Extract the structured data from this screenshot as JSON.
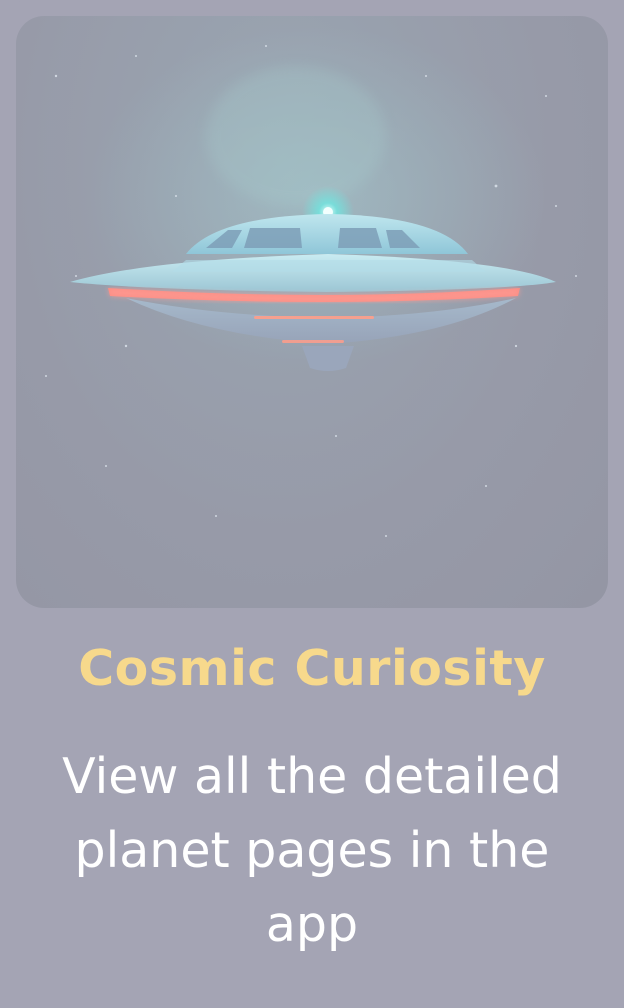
{
  "card": {
    "title": "Cosmic Curiosity",
    "description": "View all the detailed planet pages in the app",
    "image": {
      "subject": "ufo-saucer"
    }
  },
  "colors": {
    "background": "#a4a4b4",
    "title": "#f7d98c",
    "description": "#ffffff",
    "glow": "#ff8a80",
    "saucer": "#a8d8e8"
  }
}
